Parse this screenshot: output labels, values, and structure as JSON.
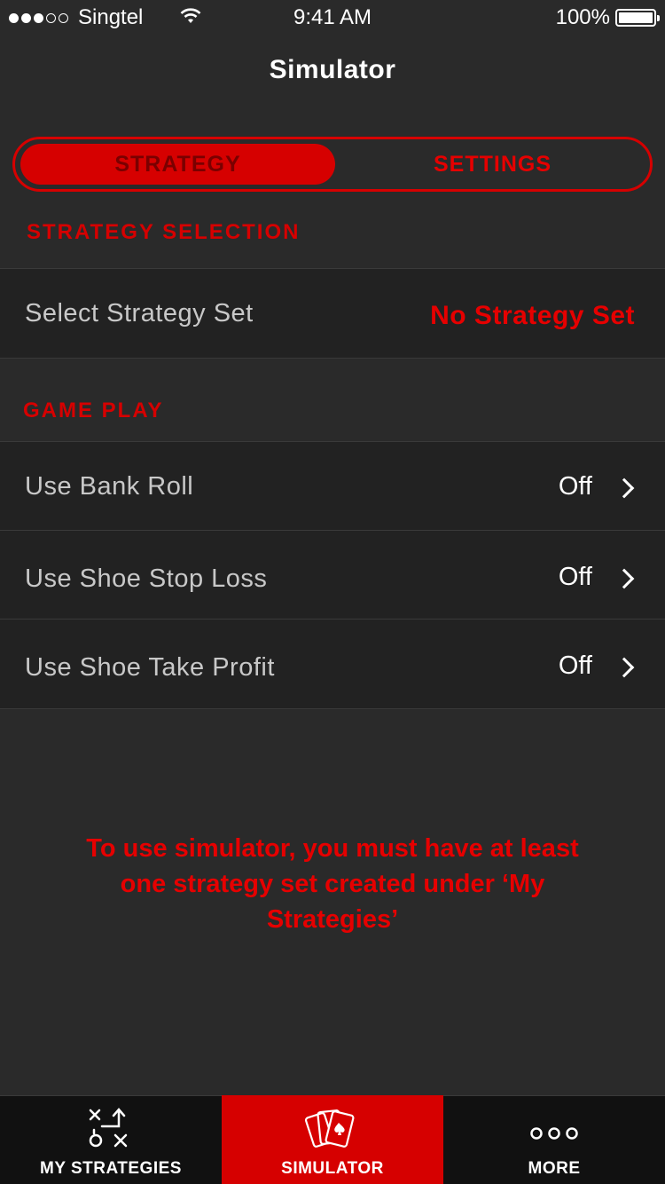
{
  "status": {
    "carrier": "Singtel",
    "time": "9:41 AM",
    "battery": "100%"
  },
  "nav": {
    "title": "Simulator"
  },
  "segments": {
    "strategy": "STRATEGY",
    "settings": "SETTINGS"
  },
  "strategy_section": {
    "header": "STRATEGY SELECTION",
    "select_label": "Select Strategy Set",
    "select_value": "No Strategy Set"
  },
  "gameplay_section": {
    "header": "GAME PLAY",
    "rows": [
      {
        "label": "Use Bank Roll",
        "value": "Off"
      },
      {
        "label": "Use Shoe Stop Loss",
        "value": "Off"
      },
      {
        "label": "Use Shoe Take Profit",
        "value": "Off"
      }
    ]
  },
  "notice": "To use simulator, you must have at least one strategy set created under ‘My Strategies’",
  "tabs": [
    {
      "label": "MY STRATEGIES",
      "icon": "playbook-icon"
    },
    {
      "label": "SIMULATOR",
      "icon": "cards-icon"
    },
    {
      "label": "MORE",
      "icon": "more-icon"
    }
  ],
  "colors": {
    "accent": "#d60000",
    "background": "#2a2a2a",
    "row": "#222222"
  }
}
